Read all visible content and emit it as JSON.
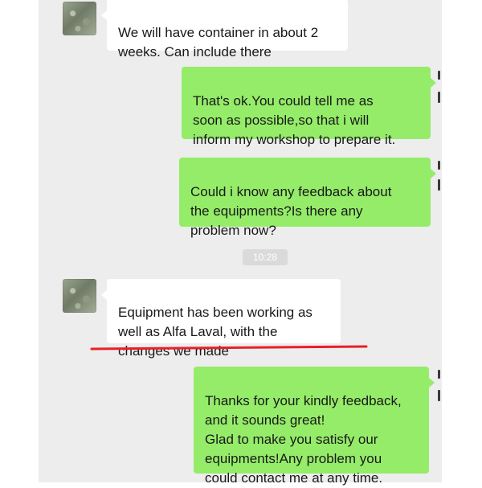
{
  "conversation": {
    "messages": [
      {
        "direction": "incoming",
        "text": "We will have container in about 2\nweeks. Can include there"
      },
      {
        "direction": "outgoing",
        "text": "That's ok.You could tell me as\nsoon as possible,so that i will\ninform my workshop to prepare it."
      },
      {
        "direction": "outgoing",
        "text": "Could i know any feedback about\nthe equipments?Is there any\nproblem now?"
      },
      {
        "direction": "incoming",
        "text": "Equipment has been working as\nwell as Alfa Laval, with the\nchanges we made"
      },
      {
        "direction": "outgoing",
        "text": "Thanks for your kindly feedback,\nand it sounds great!\nGlad to make you satisfy our\nequipments!Any problem you\ncould contact me at any time."
      }
    ],
    "timestamp": "10:28"
  },
  "colors": {
    "chat_background": "#ededed",
    "outgoing_bubble": "#95ec69",
    "incoming_bubble": "#ffffff",
    "annotation_underline": "#e8202a"
  },
  "icons": {
    "contact_avatar": "contact-avatar-photo"
  }
}
